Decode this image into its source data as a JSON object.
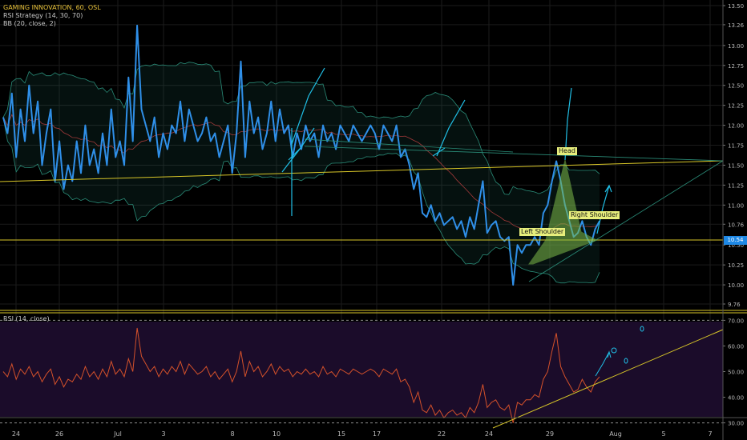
{
  "legend": {
    "title": "GAMING INNOVATION, 60, OSL",
    "strategy": "RSI Strategy (14, 30, 70)",
    "bb": "BB (20, close, 2)",
    "rsi": "RSI (14, close)"
  },
  "colors": {
    "background": "#000000",
    "price": "#2f8fe8",
    "bb_band": "#2a8c78",
    "bb_basis": "#a33a3a",
    "rsi_line": "#d4512a",
    "rsi_fill": "#1b0c2a",
    "support": "#d8c628",
    "pattern_fill": "#7dbb4a",
    "drawing": "#20bfe6",
    "grid": "#1b1b1b"
  },
  "labels": {
    "left_shoulder": "Left Shoulder",
    "head": "Head",
    "right_shoulder": "Right Shoulder",
    "last_price": "10.54"
  },
  "chart_data": [
    {
      "type": "line",
      "panel": "price",
      "title": "GAMING INNOVATION, 60, OSL",
      "ylim": [
        9.7,
        13.55
      ],
      "y_ticks": [
        9.76,
        10.0,
        10.25,
        10.5,
        10.76,
        11.0,
        11.25,
        11.5,
        11.75,
        12.0,
        12.25,
        12.5,
        12.75,
        13.0,
        13.26,
        13.5
      ],
      "y_tick_labels": [
        "9.76",
        "10.00",
        "10.25",
        "10.50",
        "10.76",
        "11.00",
        "11.25",
        "11.50",
        "11.75",
        "12.00",
        "12.25",
        "12.50",
        "12.75",
        "13.00",
        "13.26",
        "13.50"
      ],
      "x_tick_labels": [
        "24",
        "26",
        "Jul",
        "3",
        "8",
        "10",
        "15",
        "17",
        "22",
        "24",
        "29",
        "Aug",
        "5",
        "7"
      ],
      "last_price": 10.54,
      "series": [
        {
          "name": "Close",
          "values": [
            12.1,
            11.9,
            12.4,
            11.6,
            12.2,
            11.8,
            12.5,
            11.9,
            12.3,
            11.5,
            11.9,
            12.2,
            11.3,
            11.8,
            11.2,
            11.5,
            11.3,
            11.8,
            11.4,
            12.0,
            11.5,
            11.7,
            11.4,
            11.9,
            11.5,
            12.2,
            11.6,
            11.8,
            11.5,
            12.6,
            11.8,
            13.25,
            12.2,
            12.0,
            11.8,
            12.1,
            11.6,
            11.9,
            11.7,
            12.0,
            11.9,
            12.3,
            11.8,
            12.2,
            12.0,
            11.8,
            11.9,
            12.1,
            11.8,
            11.9,
            11.6,
            11.8,
            12.0,
            11.4,
            11.9,
            12.8,
            11.6,
            12.3,
            11.9,
            12.1,
            11.7,
            11.9,
            12.3,
            11.8,
            12.2,
            11.9,
            12.0,
            11.6,
            11.9,
            11.7,
            12.0,
            11.8,
            11.9,
            11.6,
            12.0,
            11.8,
            11.9,
            11.7,
            12.0,
            11.9,
            11.8,
            12.0,
            11.9,
            11.8,
            11.9,
            12.0,
            11.9,
            11.7,
            12.0,
            11.9,
            11.8,
            12.0,
            11.6,
            11.7,
            11.5,
            11.2,
            11.4,
            10.9,
            10.85,
            11.0,
            10.8,
            10.9,
            10.75,
            10.8,
            10.85,
            10.7,
            10.8,
            10.6,
            10.85,
            10.7,
            11.0,
            11.3,
            10.65,
            10.75,
            10.8,
            10.6,
            10.55,
            10.6,
            10.0,
            10.5,
            10.4,
            10.5,
            10.5,
            10.6,
            10.5,
            10.9,
            11.0,
            11.3,
            11.55,
            11.3,
            11.0,
            10.8,
            10.6,
            10.65,
            10.8,
            10.6,
            10.5,
            10.7,
            10.8
          ]
        }
      ],
      "bollinger": {
        "period": 20,
        "stddev": 2
      }
    },
    {
      "type": "line",
      "panel": "rsi",
      "title": "RSI (14, close)",
      "ylim": [
        28,
        72
      ],
      "y_ticks": [
        30,
        40,
        50,
        60,
        70
      ],
      "y_tick_labels": [
        "30.00",
        "40.00",
        "50.00",
        "60.00",
        "70.00"
      ],
      "bands": [
        30,
        70
      ],
      "series": [
        {
          "name": "RSI",
          "values": [
            50,
            48,
            53,
            47,
            51,
            49,
            52,
            48,
            50,
            46,
            49,
            51,
            45,
            48,
            44,
            47,
            46,
            49,
            47,
            52,
            48,
            50,
            47,
            51,
            48,
            54,
            49,
            51,
            48,
            55,
            50,
            67,
            56,
            53,
            50,
            52,
            48,
            51,
            49,
            52,
            50,
            54,
            49,
            53,
            51,
            49,
            50,
            52,
            48,
            50,
            47,
            49,
            51,
            46,
            50,
            58,
            48,
            54,
            50,
            52,
            48,
            50,
            53,
            49,
            52,
            50,
            51,
            48,
            50,
            49,
            51,
            49,
            50,
            48,
            52,
            49,
            50,
            48,
            51,
            50,
            49,
            51,
            50,
            49,
            50,
            51,
            50,
            48,
            51,
            50,
            49,
            51,
            46,
            47,
            44,
            38,
            42,
            35,
            34,
            37,
            33,
            35,
            32,
            34,
            35,
            33,
            34,
            32,
            36,
            34,
            38,
            45,
            36,
            38,
            39,
            36,
            35,
            37,
            30,
            38,
            37,
            39,
            39,
            41,
            40,
            47,
            50,
            58,
            65,
            52,
            48,
            45,
            42,
            43,
            47,
            44,
            42,
            46,
            48
          ]
        }
      ]
    }
  ]
}
